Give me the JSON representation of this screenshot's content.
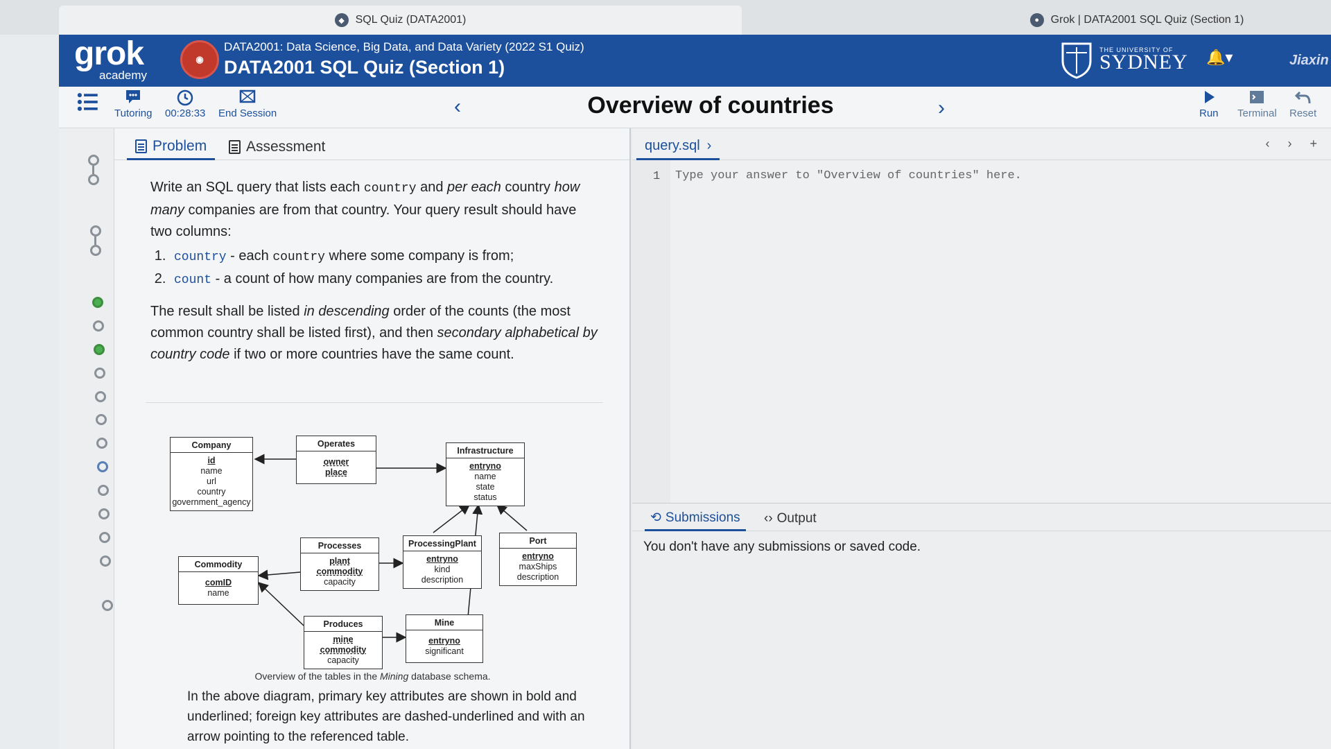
{
  "browser": {
    "tab1_title": "SQL Quiz (DATA2001)",
    "tab2_title": "Grok | DATA2001 SQL Quiz (Section 1)"
  },
  "header": {
    "logo_main": "grok",
    "logo_sub": "academy",
    "course_subtitle": "DATA2001: Data Science, Big Data, and Data Variety (2022 S1 Quiz)",
    "course_title": "DATA2001 SQL Quiz (Section 1)",
    "university_small": "THE UNIVERSITY OF",
    "university_name": "SYDNEY",
    "user_name": "Jiaxin"
  },
  "toolbar": {
    "tutoring_label": "Tutoring",
    "timer_value": "00:28:33",
    "end_session_label": "End Session",
    "problem_title": "Overview of countries",
    "run_label": "Run",
    "terminal_label": "Terminal",
    "reset_label": "Reset"
  },
  "problem_tabs": {
    "problem": "Problem",
    "assessment": "Assessment"
  },
  "problem_text": {
    "p1_a": "Write an SQL query that lists each ",
    "p1_code1": "country",
    "p1_b": " and ",
    "p1_em1": "per each",
    "p1_c": " country ",
    "p1_em2": "how many",
    "p1_d": " companies are from that country. Your query result should have two columns:",
    "li1_code": "country",
    "li1_a": " - each ",
    "li1_code2": "country",
    "li1_b": " where some company is from;",
    "li2_code": "count",
    "li2_a": " - a count of how many companies are from the country.",
    "p2_a": "The result shall be listed ",
    "p2_em1": "in descending",
    "p2_b": " order of the counts (the most common country shall be listed first), and then ",
    "p2_em2": "secondary alphabetical by country code",
    "p2_c": " if two or more countries have the same count."
  },
  "schema": {
    "company": {
      "title": "Company",
      "pk": "id",
      "attrs": [
        "name",
        "url",
        "country",
        "government_agency"
      ]
    },
    "operates": {
      "title": "Operates",
      "fks": [
        "owner",
        "place"
      ]
    },
    "infrastructure": {
      "title": "Infrastructure",
      "pk": "entryno",
      "attrs": [
        "name",
        "state",
        "status"
      ]
    },
    "commodity": {
      "title": "Commodity",
      "pk": "comID",
      "attrs": [
        "name"
      ]
    },
    "processes": {
      "title": "Processes",
      "fks": [
        "plant",
        "commodity"
      ],
      "attrs": [
        "capacity"
      ]
    },
    "processing_plant": {
      "title": "ProcessingPlant",
      "pk": "entryno",
      "attrs": [
        "kind",
        "description"
      ]
    },
    "port": {
      "title": "Port",
      "pk": "entryno",
      "attrs": [
        "maxShips",
        "description"
      ]
    },
    "produces": {
      "title": "Produces",
      "fks": [
        "mine",
        "commodity"
      ],
      "attrs": [
        "capacity"
      ]
    },
    "mine": {
      "title": "Mine",
      "pk": "entryno",
      "attrs": [
        "significant"
      ]
    }
  },
  "caption": {
    "a": "Overview of the tables in the ",
    "em": "Mining",
    "b": " database schema."
  },
  "note": "In the above diagram, primary key attributes are shown in bold and underlined; foreign key attributes are dashed-underlined and with an arrow pointing to the referenced table.",
  "editor": {
    "file_tab": "query.sql",
    "line_number": "1",
    "placeholder": "Type your answer to \"Overview of countries\" here."
  },
  "submissions": {
    "tab_submissions": "Submissions",
    "tab_output": "Output",
    "message": "You don't have any submissions or saved code."
  }
}
